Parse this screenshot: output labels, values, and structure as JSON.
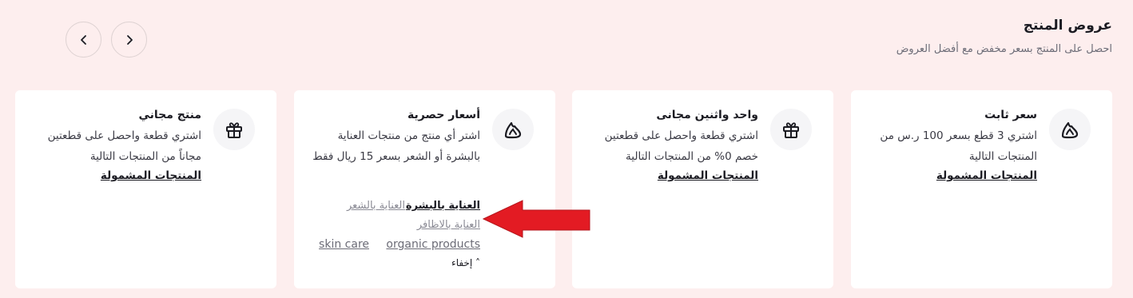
{
  "header": {
    "title": "عروض المنتج",
    "subtitle": "احصل على المنتج بسعر مخفض مع أفضل العروض"
  },
  "nav": {
    "prev_icon": "chevron-left-icon",
    "next_icon": "chevron-right-icon"
  },
  "cards": [
    {
      "icon": "brand-logo-icon",
      "title": "سعر ثابت",
      "description": "اشتري 3 قطع بسعر 100 ر.س من المنتجات التالية",
      "link": "المنتجات المشمولة"
    },
    {
      "icon": "gift-icon",
      "title": "واحد واثنين مجانى",
      "description": "اشتري قطعة واحصل على قطعتين خصم 0% من المنتجات التالية",
      "link": "المنتجات المشمولة"
    },
    {
      "icon": "brand-logo-icon",
      "title": "أسعار حصرية",
      "description": "اشتر أي منتج من منتجات العناية بالبشرة أو الشعر بسعر 15 ريال فقط",
      "tags": [
        "العناية بالبشرة",
        "العناية بالشعر",
        "العناية بالاظافر",
        "organic products",
        "skin care"
      ],
      "hide_label": "إخفاء"
    },
    {
      "icon": "gift-icon",
      "title": "منتج مجاني",
      "description": "اشتري قطعة واحصل على قطعتين مجاناً من المنتجات التالية",
      "link": "المنتجات المشمولة"
    }
  ],
  "colors": {
    "background": "#fdeeee",
    "card": "#ffffff",
    "annotation_arrow": "#e31b23"
  }
}
